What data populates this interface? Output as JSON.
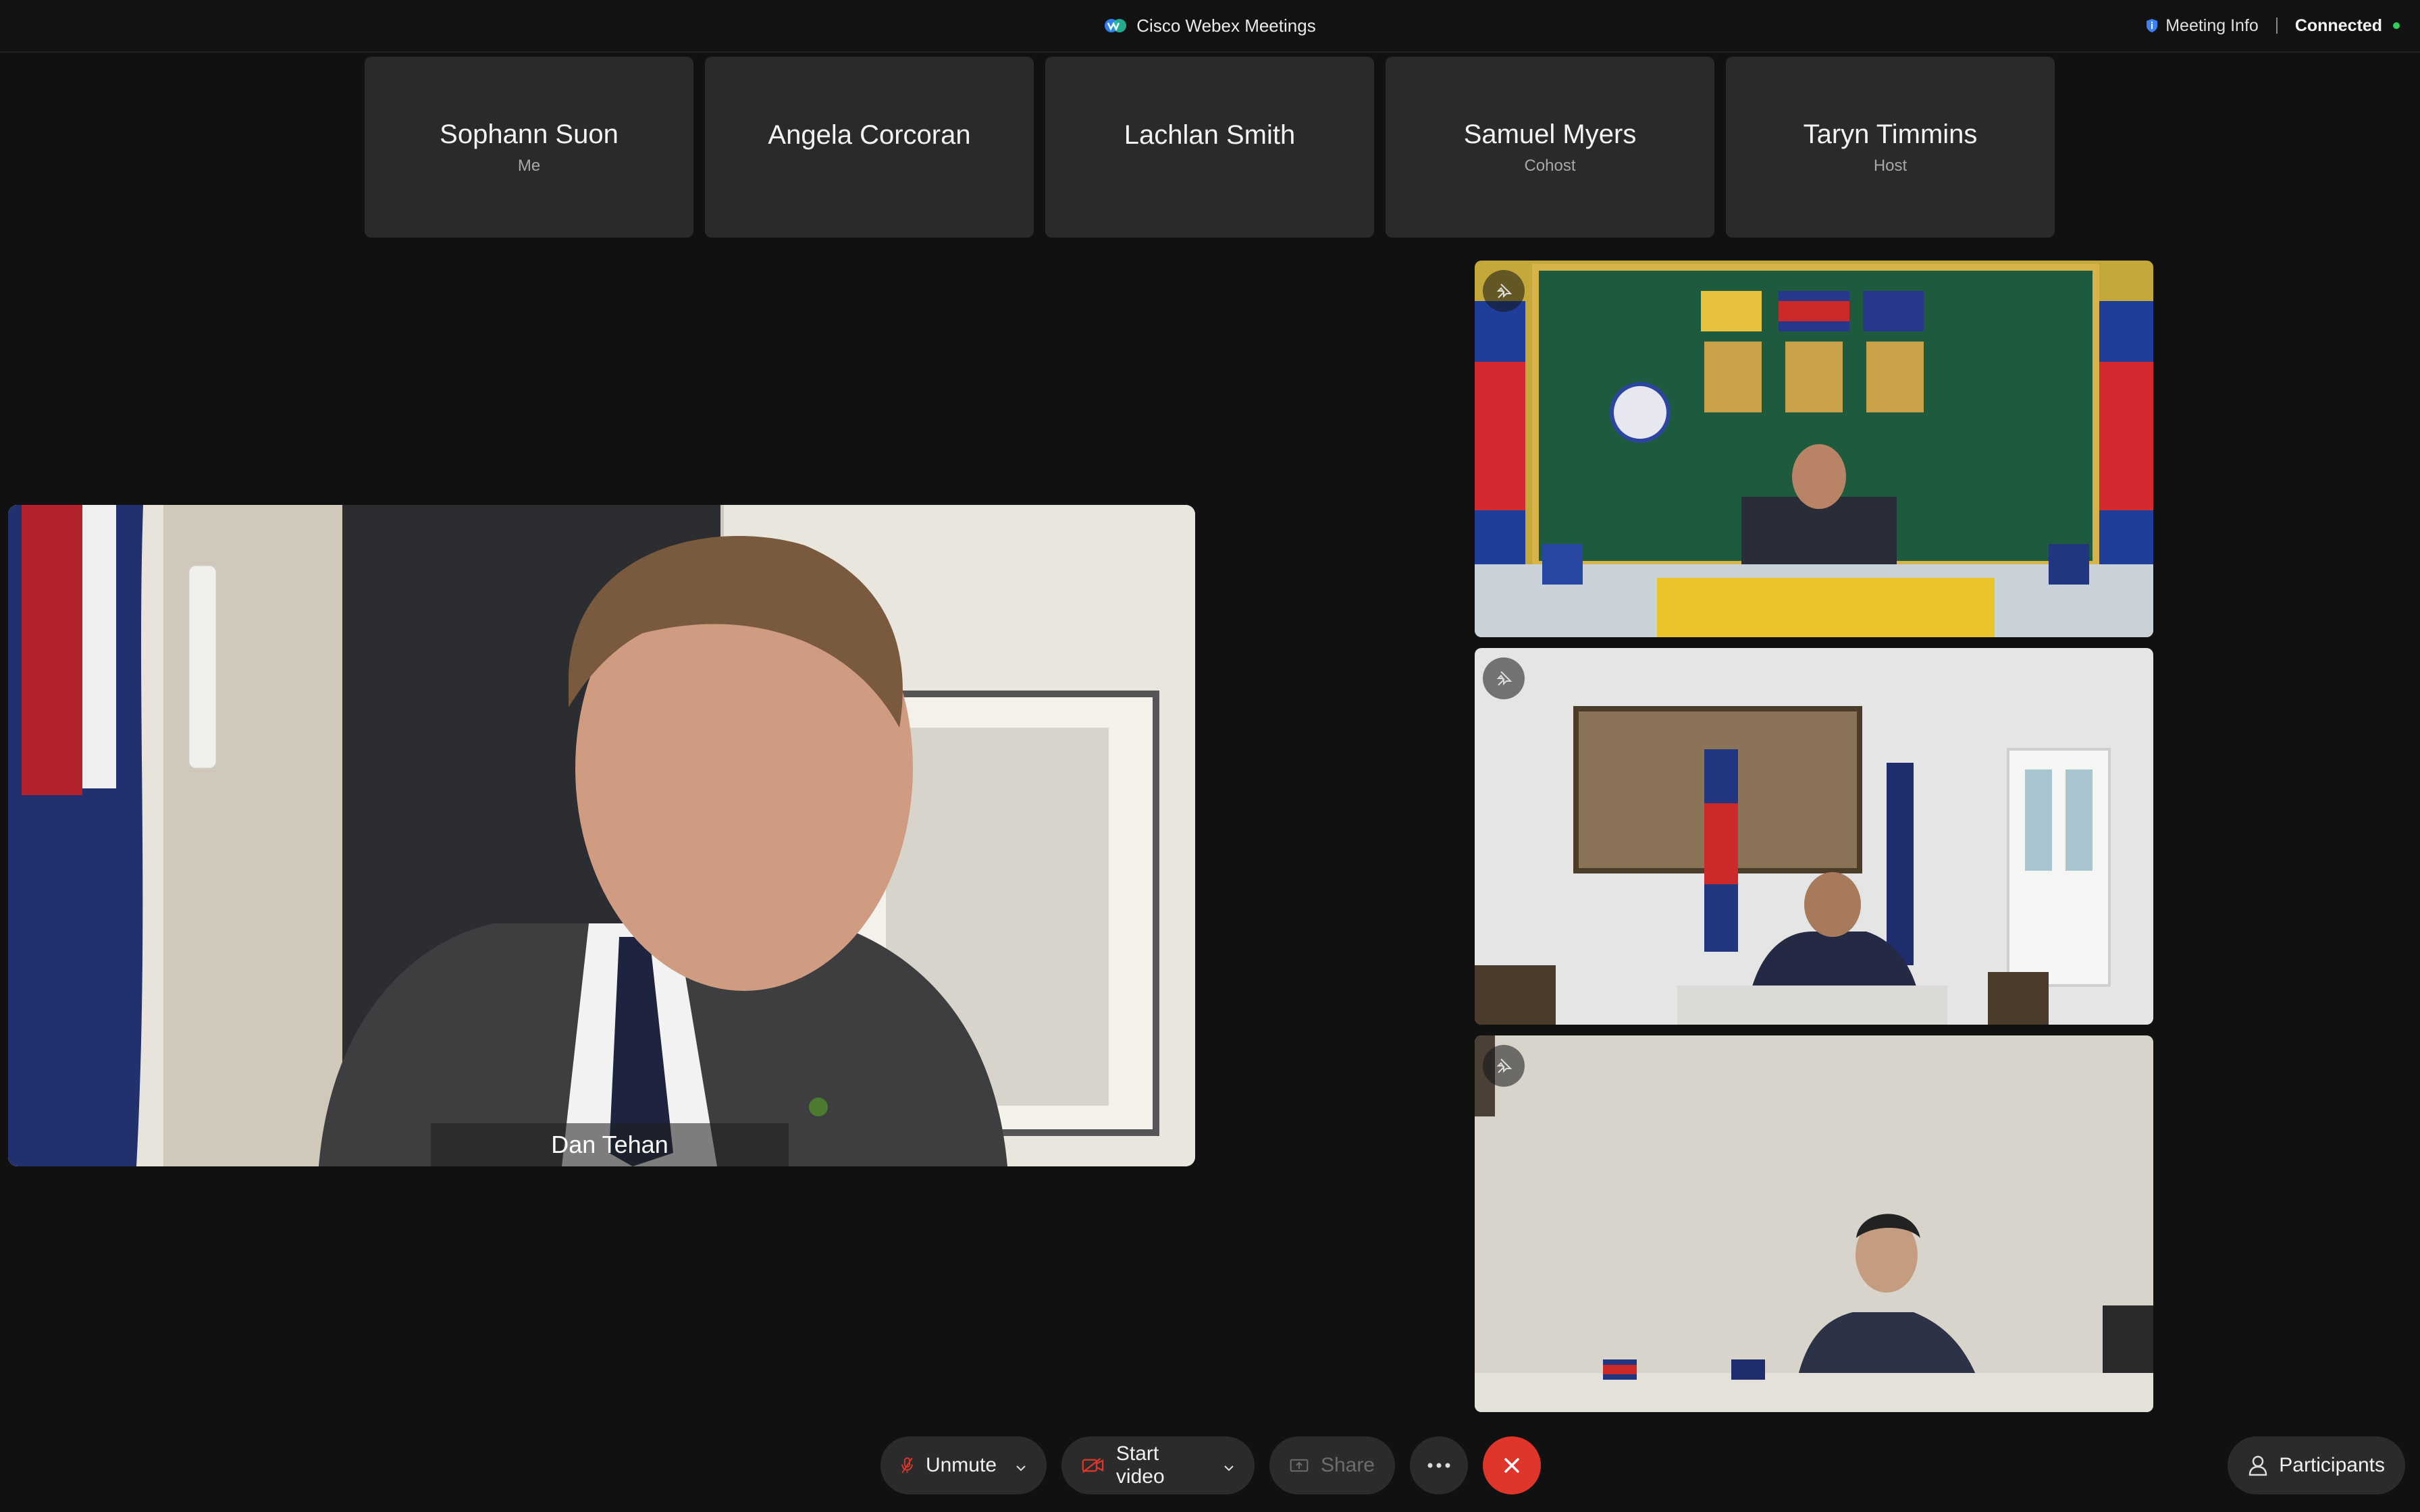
{
  "titlebar": {
    "app_title": "Cisco Webex Meetings",
    "meeting_info": "Meeting Info",
    "status": "Connected",
    "status_color": "#2fcf5b"
  },
  "participants_strip": [
    {
      "name": "Sophann Suon",
      "role": "Me"
    },
    {
      "name": "Angela Corcoran",
      "role": ""
    },
    {
      "name": "Lachlan Smith",
      "role": ""
    },
    {
      "name": "Samuel Myers",
      "role": "Cohost"
    },
    {
      "name": "Taryn Timmins",
      "role": "Host"
    }
  ],
  "main_video": {
    "speaker_name": "Dan Tehan"
  },
  "controls": {
    "unmute_label": "Unmute",
    "start_video_label": "Start video",
    "share_label": "Share",
    "participants_label": "Participants",
    "end_color": "#e0352b",
    "muted_icon_color": "#e0352b"
  }
}
